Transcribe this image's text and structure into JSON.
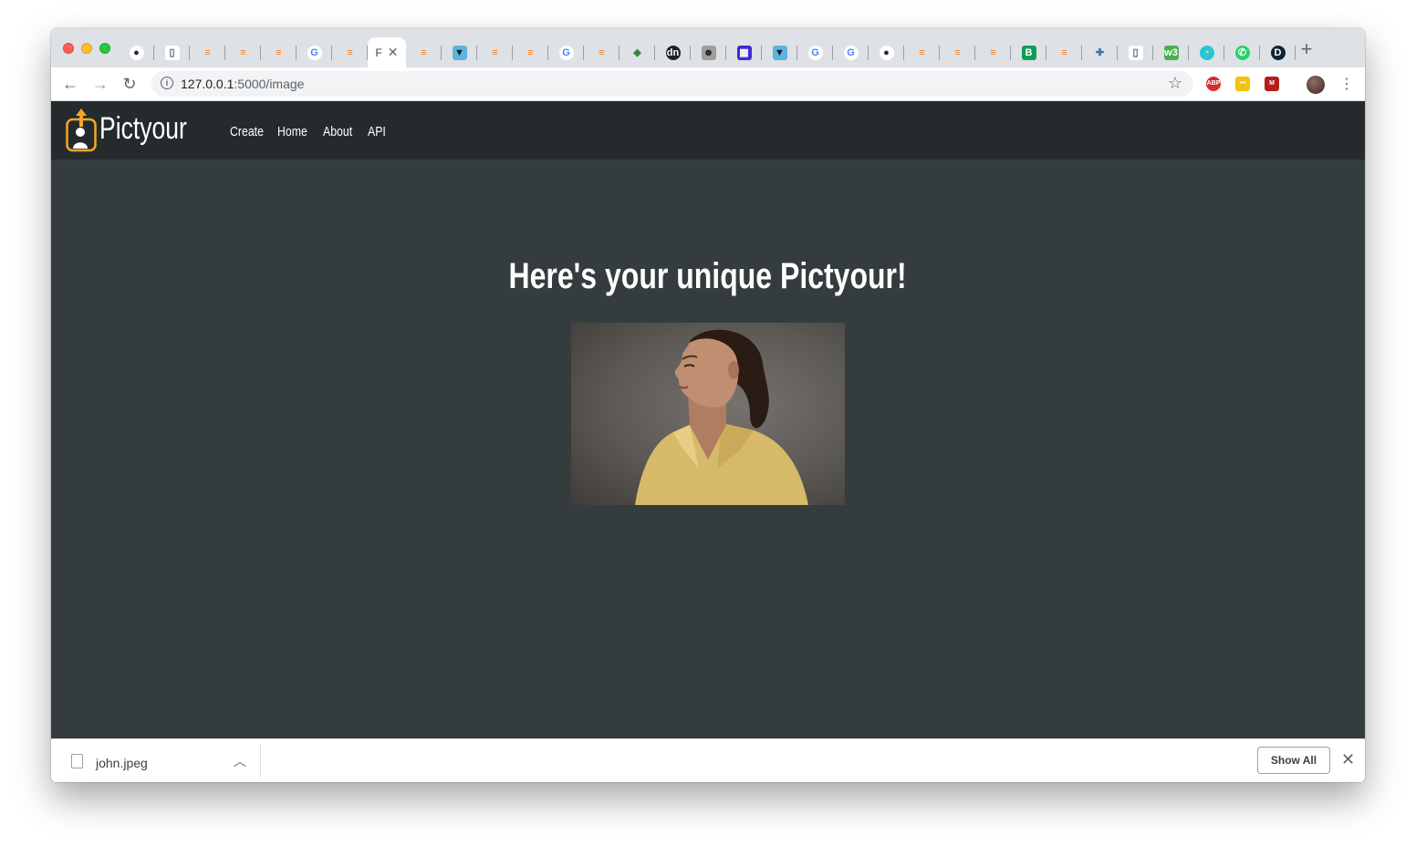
{
  "browser": {
    "tabs": [
      {
        "icon": "github-icon"
      },
      {
        "icon": "document-icon"
      },
      {
        "icon": "stackoverflow-icon"
      },
      {
        "icon": "stackoverflow-icon"
      },
      {
        "icon": "stackoverflow-icon"
      },
      {
        "icon": "google-icon"
      },
      {
        "icon": "stackoverflow-icon"
      },
      {
        "icon": "page-icon",
        "active": true,
        "label": "F",
        "close": "✕"
      },
      {
        "icon": "stackoverflow-icon"
      },
      {
        "icon": "bird-icon"
      },
      {
        "icon": "stackoverflow-icon"
      },
      {
        "icon": "stackoverflow-icon"
      },
      {
        "icon": "google-icon"
      },
      {
        "icon": "stackoverflow-icon"
      },
      {
        "icon": "diamond-icon"
      },
      {
        "icon": "dn-icon"
      },
      {
        "icon": "portrait-icon"
      },
      {
        "icon": "data-tools-icon"
      },
      {
        "icon": "bird-icon"
      },
      {
        "icon": "google-icon"
      },
      {
        "icon": "google-icon"
      },
      {
        "icon": "github-icon"
      },
      {
        "icon": "stackoverflow-icon"
      },
      {
        "icon": "stackoverflow-icon"
      },
      {
        "icon": "stackoverflow-icon"
      },
      {
        "icon": "b64-icon"
      },
      {
        "icon": "stackoverflow-icon"
      },
      {
        "icon": "python-icon"
      },
      {
        "icon": "document-icon"
      },
      {
        "icon": "w3-icon"
      },
      {
        "icon": "circle-color-icon"
      },
      {
        "icon": "whatsapp-icon"
      },
      {
        "icon": "d-icon"
      }
    ],
    "new_tab": "+",
    "url_host": "127.0.0.1",
    "url_rest": ":5000/image",
    "extensions": [
      {
        "name": "adblock-icon",
        "label": "ABP",
        "color": "#d32f2f"
      },
      {
        "name": "yellow-extension-icon",
        "label": "•••",
        "color": "#f4c20d"
      },
      {
        "name": "red-extension-icon",
        "label": "M",
        "color": "#b71c1c"
      }
    ]
  },
  "site": {
    "brand": "Pictyour",
    "nav": [
      "Create",
      "Home",
      "About",
      "API"
    ],
    "headline": "Here's your unique Pictyour!",
    "image_alt": "portrait of a woman in a yellow shirt"
  },
  "downloads": {
    "filename": "john.jpeg",
    "show_all": "Show All"
  }
}
